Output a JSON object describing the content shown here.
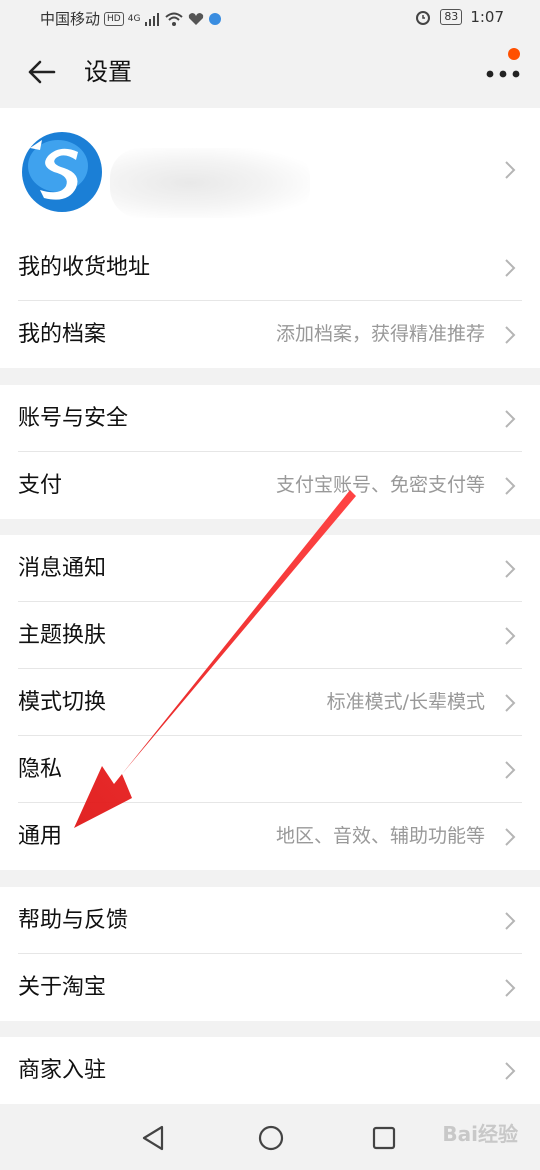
{
  "status_bar": {
    "carrier": "中国移动",
    "hd_badge": "HD",
    "network": "4G",
    "battery": "83",
    "time": "1:07"
  },
  "header": {
    "title": "设置",
    "icons": {
      "back": "arrow-left-icon",
      "more": "more-dots-icon"
    },
    "accent_color": "#ff5000"
  },
  "profile": {
    "avatar_icon": "app-logo-s"
  },
  "groups": [
    {
      "rows": [
        {
          "label": "我的收货地址",
          "hint": ""
        },
        {
          "label": "我的档案",
          "hint": "添加档案，获得精准推荐"
        }
      ]
    },
    {
      "rows": [
        {
          "label": "账号与安全",
          "hint": ""
        },
        {
          "label": "支付",
          "hint": "支付宝账号、免密支付等"
        }
      ]
    },
    {
      "rows": [
        {
          "label": "消息通知",
          "hint": ""
        },
        {
          "label": "主题换肤",
          "hint": ""
        },
        {
          "label": "模式切换",
          "hint": "标准模式/长辈模式"
        },
        {
          "label": "隐私",
          "hint": ""
        },
        {
          "label": "通用",
          "hint": "地区、音效、辅助功能等"
        }
      ]
    },
    {
      "rows": [
        {
          "label": "帮助与反馈",
          "hint": ""
        },
        {
          "label": "关于淘宝",
          "hint": ""
        }
      ]
    },
    {
      "rows": [
        {
          "label": "商家入驻",
          "hint": ""
        }
      ]
    }
  ],
  "nav_bar": {
    "icons": [
      "triangle-back-icon",
      "circle-home-icon",
      "square-recent-icon"
    ]
  },
  "watermark": "Bai经验"
}
